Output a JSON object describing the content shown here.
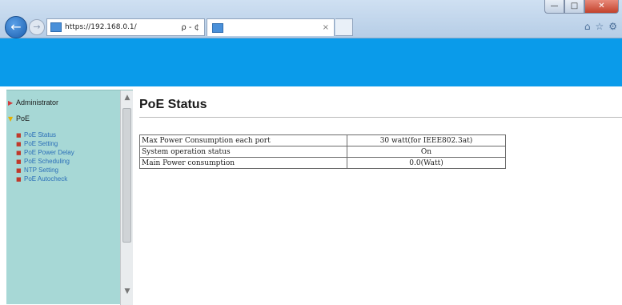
{
  "browser": {
    "url": "https://192.168.0.1/",
    "address_tools": "ρ - ¢",
    "tab_close": "×",
    "window_buttons": {
      "minimize": "—",
      "maximize": "□",
      "close": "✕"
    },
    "nav": {
      "back": "←",
      "forward": "→"
    },
    "right_icons": {
      "home": "⌂",
      "favorites": "☆",
      "settings": "⚙"
    }
  },
  "banner": {
    "color": "#0a9bea"
  },
  "sidebar": {
    "sections": [
      {
        "label": "Administrator",
        "arrow": "▶",
        "open": false
      },
      {
        "label": "PoE",
        "arrow": "▼",
        "open": true
      }
    ],
    "items": [
      {
        "label": "PoE Status"
      },
      {
        "label": "PoE Setting"
      },
      {
        "label": "PoE Power Delay"
      },
      {
        "label": "PoE Scheduling"
      },
      {
        "label": "NTP Setting"
      },
      {
        "label": "PoE Autocheck"
      }
    ],
    "scroll_up": "▲",
    "scroll_down": "▼",
    "bullet": "■"
  },
  "main": {
    "title": "PoE Status",
    "rows": [
      {
        "label": "Max Power Consumption each port",
        "value": "30 watt(for IEEE802.3at)"
      },
      {
        "label": "System operation status",
        "value": "On"
      },
      {
        "label": "Main Power consumption",
        "value": "0.0(Watt)"
      }
    ]
  }
}
